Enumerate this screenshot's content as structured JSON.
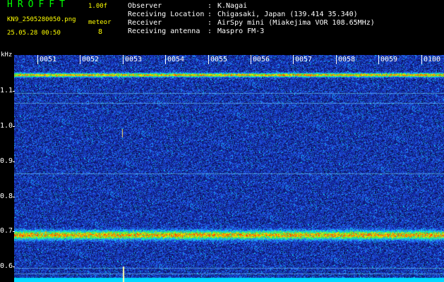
{
  "header": {
    "app_title": "HROFFT",
    "version": "1.00f",
    "filename": "KN9_2505280050.png",
    "meteor_label": "meteor",
    "timestamp": "25.05.28 00:50",
    "meteor_count": "8"
  },
  "info": [
    {
      "key": "Observer",
      "value": "K.Nagai"
    },
    {
      "key": "Receiving Location",
      "value": "Chigasaki, Japan (139.414 35.340)"
    },
    {
      "key": "Receiver",
      "value": "AirSpy mini (Miakejima VOR 108.65MHz)"
    },
    {
      "key": "Receiving antenna",
      "value": "Maspro FM-3"
    }
  ],
  "axis": {
    "unit": "kHz",
    "y_ticks": [
      "1.1",
      "1.0",
      "0.9",
      "0.8",
      "0.7",
      "0.6"
    ],
    "x_ticks": [
      "0051",
      "0052",
      "0053",
      "0054",
      "0055",
      "0056",
      "0057",
      "0058",
      "0059",
      "0100"
    ]
  },
  "colors": {
    "title": "#00ff00",
    "meta": "#ffff00",
    "background": "#0a1040"
  }
}
